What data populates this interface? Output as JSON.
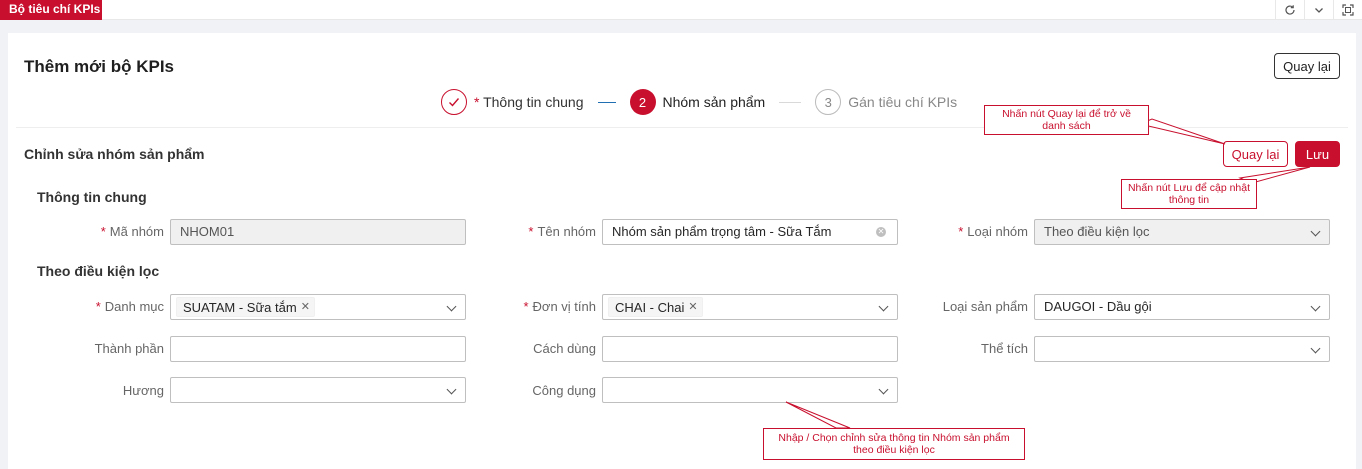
{
  "topbar": {
    "tab_label": "Bộ tiêu chí KPIs",
    "icons": [
      "refresh-icon",
      "chevron-down-icon",
      "fullscreen-icon"
    ]
  },
  "page": {
    "title": "Thêm mới bộ KPIs",
    "back_top_label": "Quay lại"
  },
  "steps": [
    {
      "label": "Thông tin chung",
      "required_mark": "*",
      "status": "done"
    },
    {
      "number": "2",
      "label": "Nhóm sản phẩm",
      "status": "active"
    },
    {
      "number": "3",
      "label": "Gán tiêu chí KPIs",
      "status": "wait"
    }
  ],
  "section": {
    "title": "Chỉnh sửa nhóm sản phẩm",
    "back_label": "Quay lại",
    "save_label": "Lưu"
  },
  "general": {
    "title": "Thông tin chung",
    "ma_nhom": {
      "label": "Mã nhóm",
      "value": "NHOM01"
    },
    "ten_nhom": {
      "label": "Tên nhóm",
      "value": "Nhóm sản phẩm trọng tâm - Sữa Tắm"
    },
    "loai_nhom": {
      "label": "Loại nhóm",
      "value": "Theo điều kiện lọc"
    }
  },
  "filter": {
    "title": "Theo điều kiện lọc",
    "danh_muc": {
      "label": "Danh mục",
      "tag": "SUATAM - Sữa tắm"
    },
    "don_vi_tinh": {
      "label": "Đơn vị tính",
      "tag": "CHAI - Chai"
    },
    "loai_san_pham": {
      "label": "Loại sản phẩm",
      "value": "DAUGOI - Dầu gội"
    },
    "thanh_phan": {
      "label": "Thành phần",
      "value": ""
    },
    "cach_dung": {
      "label": "Cách dùng",
      "value": ""
    },
    "the_tich": {
      "label": "Thể tích",
      "value": ""
    },
    "huong": {
      "label": "Hương",
      "value": ""
    },
    "cong_dung": {
      "label": "Công dụng",
      "value": ""
    }
  },
  "callouts": {
    "back": "Nhấn nút Quay lại để trở về danh sách",
    "save": "Nhấn nút Lưu để cập nhật thông tin",
    "edit": "Nhập / Chọn chỉnh sửa thông tin Nhóm sản phẩm theo điều kiện lọc"
  },
  "colors": {
    "accent": "#c8102e"
  }
}
